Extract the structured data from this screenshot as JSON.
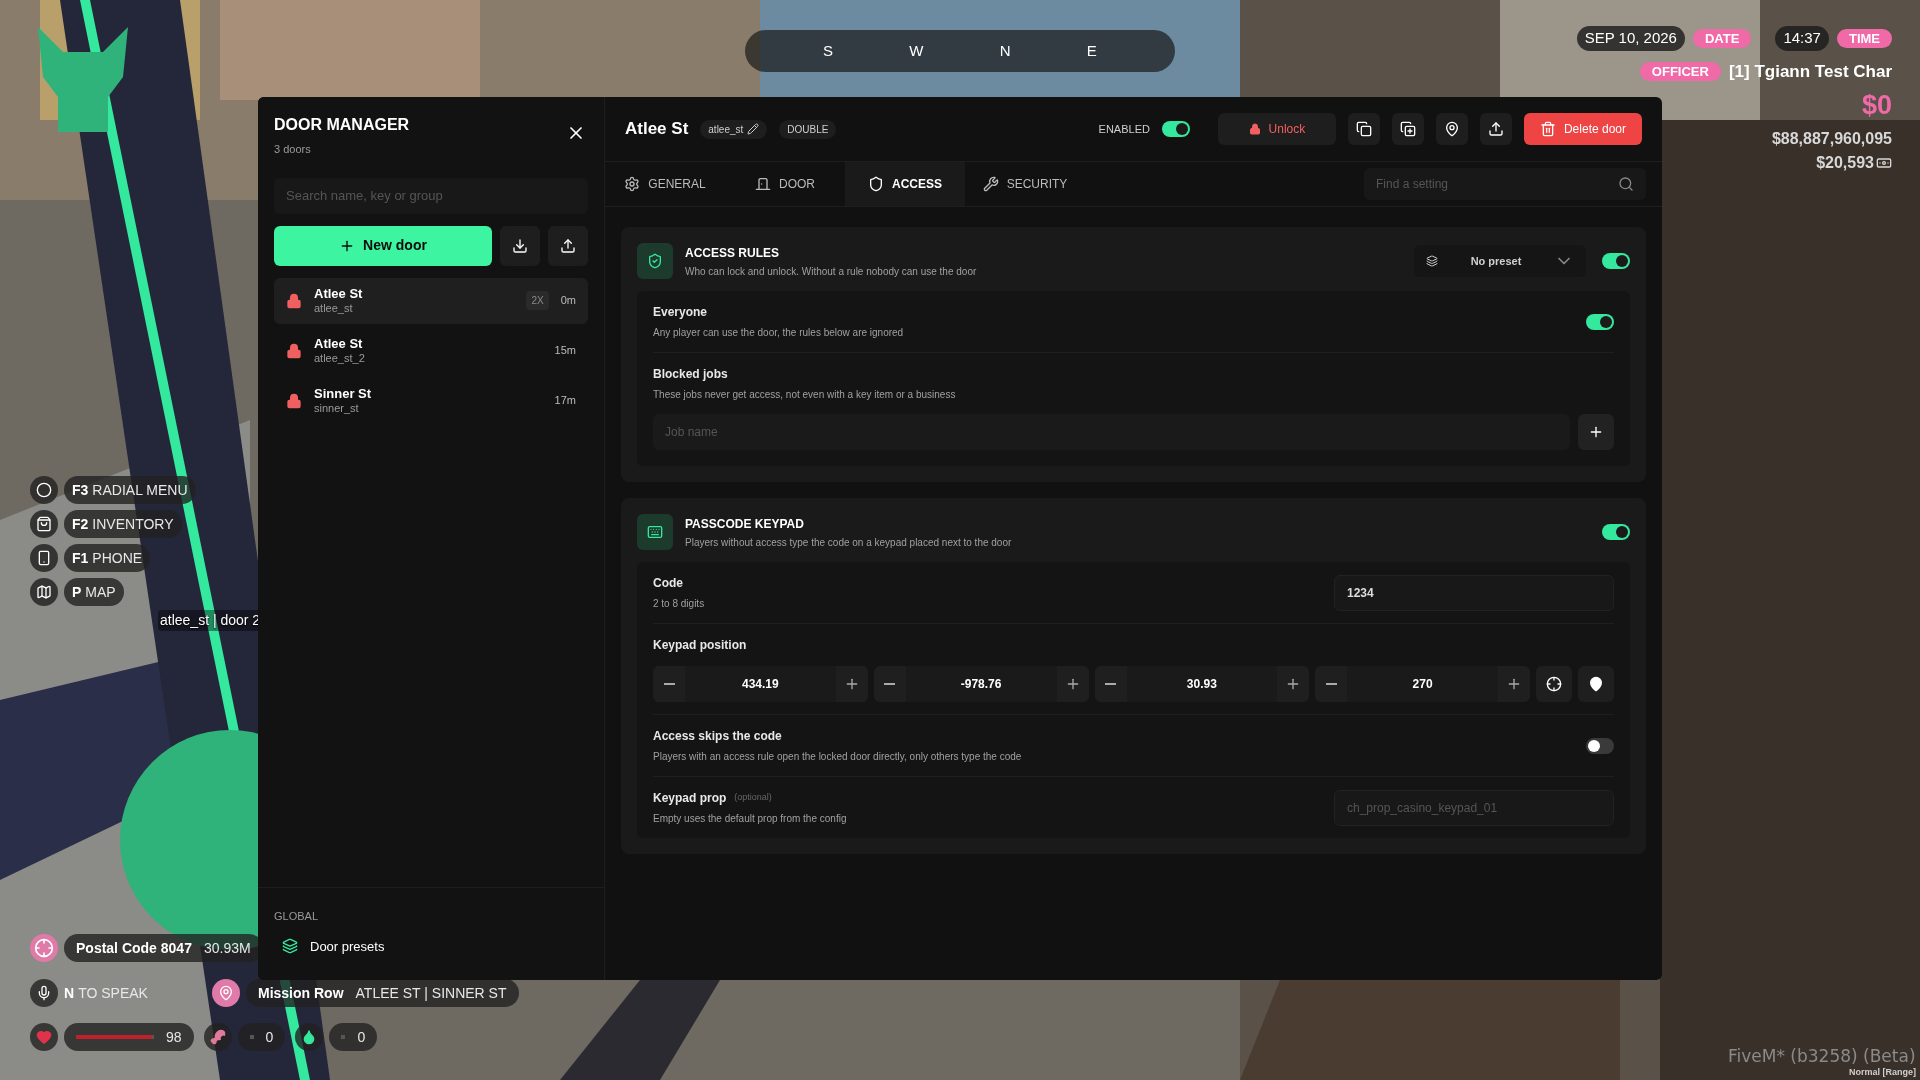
{
  "hud": {
    "compass": [
      "S",
      "W",
      "N",
      "E"
    ],
    "date": "SEP 10, 2026",
    "date_label": "DATE",
    "time": "14:37",
    "time_label": "TIME",
    "job": "OFFICER",
    "character": "[1] Tgiann Test Char",
    "cash": "$0",
    "bank": "$88,887,960,095",
    "dirty_money": "$20,593",
    "keybinds": [
      {
        "kind": "radial",
        "key": "F3",
        "label": "RADIAL MENU"
      },
      {
        "kind": "inventory",
        "key": "F2",
        "label": "INVENTORY"
      },
      {
        "kind": "phone",
        "key": "F1",
        "label": "PHONE"
      },
      {
        "kind": "map",
        "key": "P",
        "label": "MAP"
      }
    ],
    "world_label": "atlee_st | door 2",
    "postal": {
      "title": "Postal Code 8047",
      "distance": "30.93M"
    },
    "voice": {
      "key": "N",
      "label": "TO SPEAK"
    },
    "location": {
      "area": "Mission Row",
      "streets": "ATLEE ST | SINNER ST"
    },
    "stats": [
      {
        "kind": "health",
        "value": "98",
        "level": 0.98
      },
      {
        "kind": "hunger",
        "value": "0"
      },
      {
        "kind": "thirst",
        "value": "0"
      }
    ],
    "build": "FiveM* (b3258) (Beta)",
    "voice_range": "Normal [Range]"
  },
  "sidebar": {
    "title": "DOOR MANAGER",
    "count": "3 doors",
    "search": {
      "placeholder": "Search name, key or group"
    },
    "new_button": "New door",
    "doors": [
      {
        "name": "Atlee St",
        "key": "atlee_st",
        "badge": "2X",
        "age": "0m",
        "selected": true
      },
      {
        "name": "Atlee St",
        "key": "atlee_st_2",
        "age": "15m",
        "selected": false
      },
      {
        "name": "Sinner St",
        "key": "sinner_st",
        "age": "17m",
        "selected": false
      }
    ],
    "footer_heading": "GLOBAL",
    "footer_item": "Door presets"
  },
  "editor": {
    "title": "Atlee St",
    "key": "atlee_st",
    "type": "DOUBLE",
    "enabled": {
      "label": "ENABLED",
      "on": true
    },
    "unlock": "Unlock",
    "delete": "Delete door",
    "tabs": [
      {
        "kind": "general",
        "label": "GENERAL",
        "selected": false
      },
      {
        "kind": "door",
        "label": "DOOR",
        "selected": false
      },
      {
        "kind": "access",
        "label": "ACCESS",
        "selected": true
      },
      {
        "kind": "security",
        "label": "SECURITY",
        "selected": false
      }
    ],
    "search": {
      "placeholder": "Find a setting"
    },
    "access": {
      "title": "ACCESS RULES",
      "subtitle": "Who can lock and unlock. Without a rule nobody can use the door",
      "preset": "No preset",
      "on": true,
      "everyone": {
        "label": "Everyone",
        "hint": "Any player can use the door, the rules below are ignored",
        "on": true
      },
      "blocked": {
        "label": "Blocked jobs",
        "hint": "These jobs never get access, not even with a key item or a business",
        "placeholder": "Job name"
      }
    },
    "keypad": {
      "title": "PASSCODE KEYPAD",
      "subtitle": "Players without access type the code on a keypad placed next to the door",
      "on": true,
      "code": {
        "label": "Code",
        "hint": "2 to 8 digits",
        "value": "1234"
      },
      "position": {
        "label": "Keypad position",
        "values": [
          "434.19",
          "-978.76",
          "30.93",
          "270"
        ]
      },
      "skip": {
        "label": "Access skips the code",
        "hint": "Players with an access rule open the locked door directly, only others type the code",
        "on": false
      },
      "prop": {
        "label": "Keypad prop",
        "tag": "(optional)",
        "hint": "Empty uses the default prop from the config",
        "placeholder": "ch_prop_casino_keypad_01"
      }
    }
  }
}
